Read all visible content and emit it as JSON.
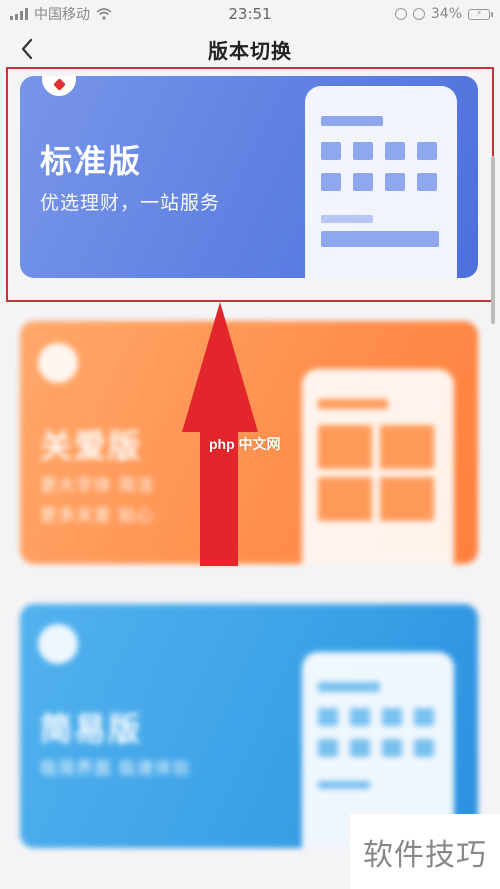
{
  "status_bar": {
    "carrier": "中国移动",
    "time": "23:51",
    "battery_percent": "34%"
  },
  "nav": {
    "title": "版本切换"
  },
  "cards": {
    "standard": {
      "title": "标准版",
      "subtitle": "优选理财，一站服务",
      "selected": true
    },
    "care": {
      "title": "关爱版",
      "subtitle_line1": "更大字体  简洁",
      "subtitle_line2": "更多关爱  贴心"
    },
    "simple": {
      "title": "简易版",
      "subtitle": "极简界面  极速体验"
    }
  },
  "watermarks": {
    "center": "php 中文网",
    "corner": "软件技巧"
  },
  "colors": {
    "standard_card": "#5f80e2",
    "care_card": "#ff8e4c",
    "simple_card": "#3aa0e6",
    "selection_frame": "#c9333a",
    "annotation_arrow": "#e3262b"
  },
  "icons": {
    "back": "chevron-left-icon",
    "wifi": "wifi-icon",
    "battery": "battery-icon",
    "signal": "signal-icon",
    "alarm": "alarm-icon",
    "lock": "rotation-lock-icon"
  }
}
